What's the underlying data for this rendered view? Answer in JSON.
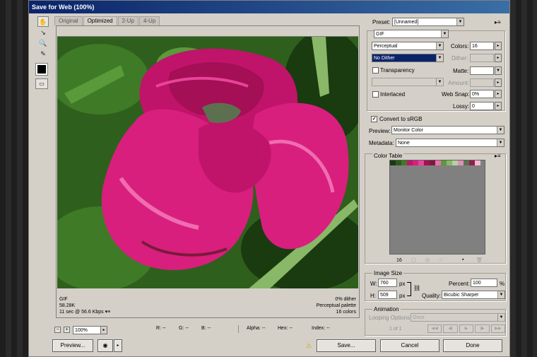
{
  "window": {
    "title": "Save for Web (100%)"
  },
  "tabs": [
    "Original",
    "Optimized",
    "2-Up",
    "4-Up"
  ],
  "preview_info": {
    "left": [
      "GIF",
      "58.28K",
      "11 sec @ 56.6 Kbps"
    ],
    "right": [
      "0% dither",
      "Perceptual palette",
      "16 colors"
    ]
  },
  "status": {
    "zoom": "100%",
    "r": "R: --",
    "g": "G: --",
    "b": "B: --",
    "alpha": "Alpha: --",
    "hex": "Hex: --",
    "index": "Index: --"
  },
  "buttons": {
    "preview": "Preview...",
    "save": "Save...",
    "cancel": "Cancel",
    "done": "Done"
  },
  "settings": {
    "preset_label": "Preset:",
    "preset_value": "[Unnamed]",
    "format": "GIF",
    "reduction": "Perceptual",
    "dither_algo": "No Dither",
    "transparency_label": "Transparency",
    "interlaced_label": "Interlaced",
    "colors_label": "Colors:",
    "colors_value": "16",
    "dither_label": "Dither:",
    "matte_label": "Matte:",
    "amount_label": "Amount:",
    "websnap_label": "Web Snap:",
    "websnap_value": "0%",
    "lossy_label": "Lossy:",
    "lossy_value": "0",
    "convert_label": "Convert to sRGB",
    "preview_label": "Preview:",
    "preview_value": "Monitor Color",
    "metadata_label": "Metadata:",
    "metadata_value": "None"
  },
  "color_table": {
    "label": "Color Table",
    "count": "16",
    "colors": [
      "#1a3a10",
      "#2d5a1a",
      "#3f7a26",
      "#c0146a",
      "#d81f7e",
      "#e8449a",
      "#a40f55",
      "#7a1a3c",
      "#f06cb0",
      "#5a9a3a",
      "#88b868",
      "#b4d0a0",
      "#e090b8",
      "#5c7050",
      "#902048",
      "#f4b8d4"
    ]
  },
  "image_size": {
    "label": "Image Size",
    "w_label": "W:",
    "w_value": "760",
    "h_label": "H:",
    "h_value": "509",
    "unit": "px",
    "percent_label": "Percent:",
    "percent_value": "100",
    "percent_unit": "%",
    "quality_label": "Quality:",
    "quality_value": "Bicubic Sharper"
  },
  "animation": {
    "label": "Animation",
    "looping_label": "Looping Options:",
    "looping_value": "Once",
    "frame": "1 of 1"
  }
}
